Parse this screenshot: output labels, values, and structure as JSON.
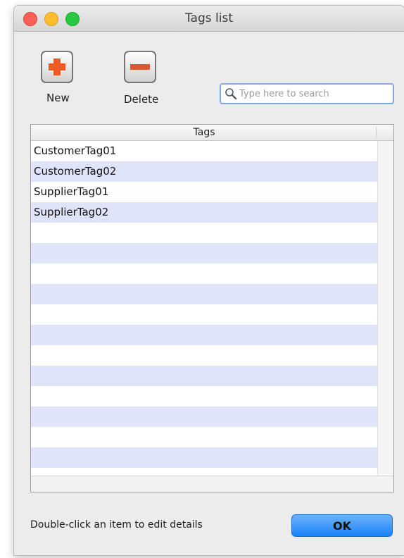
{
  "window": {
    "title": "Tags list"
  },
  "toolbar": {
    "new_label": "New",
    "delete_label": "Delete"
  },
  "search": {
    "placeholder": "Type here to search",
    "value": ""
  },
  "table": {
    "header": "Tags",
    "rows": [
      "CustomerTag01",
      "CustomerTag02",
      "SupplierTag01",
      "SupplierTag02",
      "",
      "",
      "",
      "",
      "",
      "",
      "",
      "",
      "",
      "",
      "",
      "",
      ""
    ]
  },
  "footer": {
    "hint": "Double-click an item to edit details",
    "ok_label": "OK"
  },
  "colors": {
    "row_alt": "#dfe4fa",
    "ok_button": "#1a82fb",
    "plus_icon": "#f05a24",
    "minus_icon": "#d9582d"
  },
  "icons": [
    "close-button",
    "minimize-button",
    "zoom-button",
    "plus-icon",
    "minus-icon",
    "magnifier-icon"
  ]
}
